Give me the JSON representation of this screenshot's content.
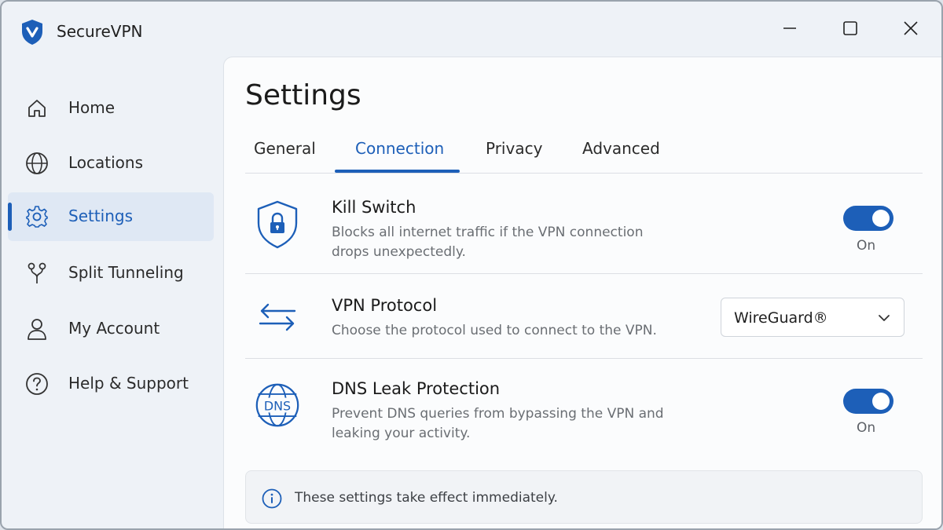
{
  "app": {
    "title": "SecureVPN",
    "accent_color": "#1d5fb8"
  },
  "window_controls": [
    {
      "name": "minimize",
      "icon": "minimize-icon"
    },
    {
      "name": "maximize",
      "icon": "maximize-icon"
    },
    {
      "name": "close",
      "icon": "close-icon"
    }
  ],
  "sidebar": {
    "items": [
      {
        "label": "Home",
        "icon": "home-icon",
        "active": false
      },
      {
        "label": "Locations",
        "icon": "globe-icon",
        "active": false
      },
      {
        "label": "Settings",
        "icon": "gear-icon",
        "active": true
      },
      {
        "label": "Split Tunneling",
        "icon": "split-icon",
        "active": false
      },
      {
        "label": "My Account",
        "icon": "user-icon",
        "active": false
      },
      {
        "label": "Help & Support",
        "icon": "help-icon",
        "active": false
      }
    ]
  },
  "main": {
    "title": "Settings",
    "tabs": [
      {
        "label": "General",
        "active": false
      },
      {
        "label": "Connection",
        "active": true
      },
      {
        "label": "Privacy",
        "active": false
      },
      {
        "label": "Advanced",
        "active": false
      }
    ],
    "settings": {
      "kill_switch": {
        "title": "Kill Switch",
        "description": "Blocks all internet traffic if the VPN connection drops unexpectedly.",
        "icon": "shield-lock-icon",
        "enabled": true,
        "state_label": "On"
      },
      "vpn_protocol": {
        "title": "VPN Protocol",
        "description": "Choose the protocol used to connect to the VPN.",
        "icon": "arrows-exchange-icon",
        "selected": "WireGuard®"
      },
      "dns_leak": {
        "title": "DNS Leak Protection",
        "description": "Prevent DNS queries from bypassing the VPN and leaking your activity.",
        "icon": "dns-globe-icon",
        "icon_text": "DNS",
        "enabled": true,
        "state_label": "On"
      }
    },
    "info": {
      "text": "These settings take effect immediately.",
      "icon": "info-icon"
    }
  }
}
